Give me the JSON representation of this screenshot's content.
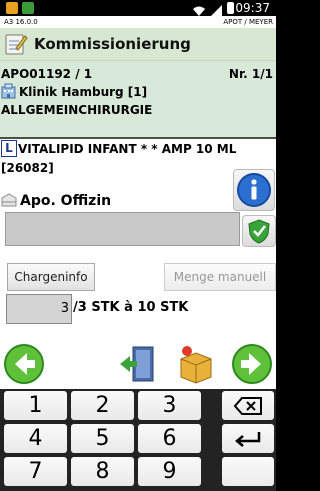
{
  "status_bar": {
    "time": "09:37"
  },
  "version_bar": {
    "version": "A3 16.0.0",
    "user": "APOT / MEYER"
  },
  "title_bar": {
    "title": "Kommissionierung"
  },
  "order": {
    "id": "APO01192 / 1",
    "nr": "Nr. 1/1",
    "clinic": "Klinik Hamburg [1]",
    "department": "ALLGEMEINCHIRURGIE"
  },
  "article": {
    "badge": "L",
    "name": "VITALIPID INFANT * * AMP 10 ML",
    "code": "[26082]"
  },
  "location": {
    "label": "Apo. Offizin",
    "value": ""
  },
  "buttons": {
    "charge": "Chargeninfo",
    "menge": "Menge manuell"
  },
  "quantity": {
    "value": "3",
    "text": "/3 STK à 10 STK"
  },
  "keypad": {
    "keys": [
      "1",
      "2",
      "3",
      "4",
      "5",
      "6",
      "7",
      "8",
      "9"
    ],
    "extra": {
      "dash": "-",
      "dot": "."
    }
  }
}
